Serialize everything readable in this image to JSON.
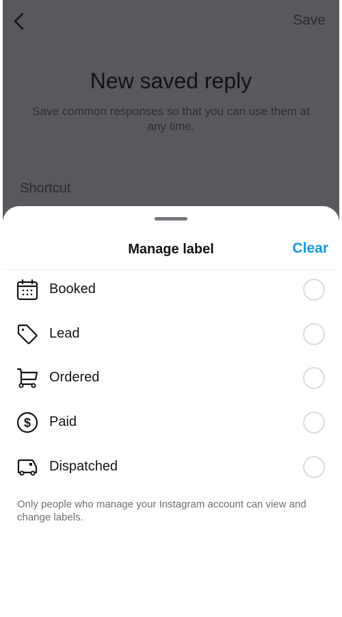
{
  "background_page": {
    "back_icon": "chevron-left-icon",
    "save_label": "Save",
    "title": "New saved reply",
    "subtitle": "Save common responses so that you can use them at any time.",
    "shortcut_label": "Shortcut"
  },
  "sheet": {
    "title": "Manage label",
    "clear_label": "Clear",
    "clear_color": "#1a95e0",
    "labels": [
      {
        "label": "Booked",
        "icon": "calendar-icon",
        "selected": false
      },
      {
        "label": "Lead",
        "icon": "tag-icon",
        "selected": false
      },
      {
        "label": "Ordered",
        "icon": "shopping-cart-icon",
        "selected": false
      },
      {
        "label": "Paid",
        "icon": "dollar-circle-icon",
        "selected": false
      },
      {
        "label": "Dispatched",
        "icon": "delivery-truck-icon",
        "selected": false
      }
    ],
    "footnote": "Only people who manage your Instagram account can view and change labels."
  }
}
